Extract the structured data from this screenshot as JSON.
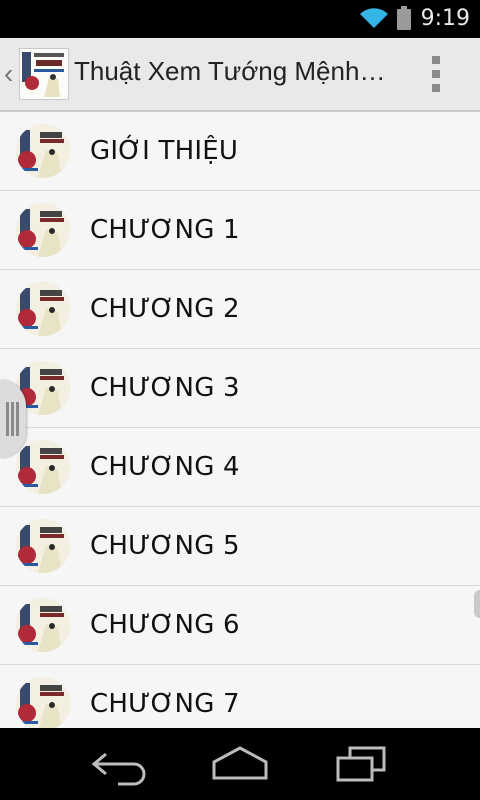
{
  "status_bar": {
    "time": "9:19",
    "wifi_icon": "wifi-icon",
    "battery_icon": "battery-icon"
  },
  "action_bar": {
    "title": "Thuật Xem Tướng Mệnh…",
    "logo_icon": "app-logo-book-cover",
    "up_icon": "up-caret-icon",
    "overflow_icon": "overflow-menu-icon"
  },
  "list": {
    "items": [
      {
        "label": "GIỚI THIỆU",
        "icon": "book-cover-thumbnail"
      },
      {
        "label": "CHƯƠNG 1",
        "icon": "book-cover-thumbnail"
      },
      {
        "label": "CHƯƠNG 2",
        "icon": "book-cover-thumbnail"
      },
      {
        "label": "CHƯƠNG 3",
        "icon": "book-cover-thumbnail"
      },
      {
        "label": "CHƯƠNG 4",
        "icon": "book-cover-thumbnail"
      },
      {
        "label": "CHƯƠNG 5",
        "icon": "book-cover-thumbnail"
      },
      {
        "label": "CHƯƠNG 6",
        "icon": "book-cover-thumbnail"
      },
      {
        "label": "CHƯƠNG 7",
        "icon": "book-cover-thumbnail"
      }
    ]
  },
  "nav_bar": {
    "back_icon": "back-icon",
    "home_icon": "home-icon",
    "recents_icon": "recent-apps-icon"
  },
  "colors": {
    "status_bar": "#000000",
    "action_bar": "#e9e9e9",
    "list_bg": "#f6f6f6",
    "divider": "#d9d9d9",
    "text": "#111111"
  }
}
